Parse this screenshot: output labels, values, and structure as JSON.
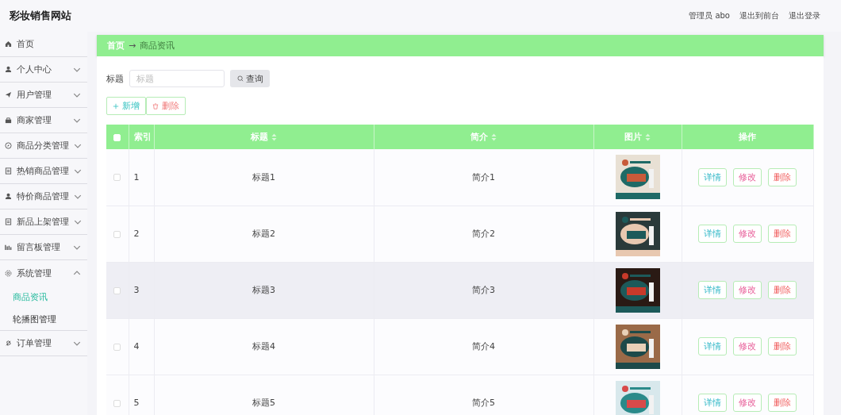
{
  "header": {
    "title": "彩妆销售网站",
    "links": [
      "管理员 abo",
      "退出到前台",
      "退出登录"
    ]
  },
  "sidebar": {
    "items": [
      {
        "label": "首页",
        "kind": "home",
        "expandable": false
      },
      {
        "label": "个人中心",
        "kind": "user",
        "expandable": true,
        "expanded": false
      },
      {
        "label": "用户管理",
        "kind": "send",
        "expandable": true,
        "expanded": false
      },
      {
        "label": "商家管理",
        "kind": "shop",
        "expandable": true,
        "expanded": false
      },
      {
        "label": "商品分类管理",
        "kind": "compass",
        "expandable": true,
        "expanded": false
      },
      {
        "label": "热销商品管理",
        "kind": "doc",
        "expandable": true,
        "expanded": false
      },
      {
        "label": "特价商品管理",
        "kind": "user",
        "expandable": true,
        "expanded": false
      },
      {
        "label": "新品上架管理",
        "kind": "doc",
        "expandable": true,
        "expanded": false
      },
      {
        "label": "留言板管理",
        "kind": "chart",
        "expandable": true,
        "expanded": false
      },
      {
        "label": "系统管理",
        "kind": "gear",
        "expandable": true,
        "expanded": true,
        "children": [
          {
            "label": "商品资讯",
            "selected": true
          },
          {
            "label": "轮播图管理",
            "selected": false
          }
        ]
      },
      {
        "label": "订单管理",
        "kind": "bell",
        "expandable": true,
        "expanded": false
      }
    ]
  },
  "breadcrumb": {
    "home": "首页",
    "arrow": "→",
    "current": "商品资讯"
  },
  "search": {
    "label": "标题",
    "placeholder": "标题",
    "button": "查询"
  },
  "actions": {
    "add": "新增",
    "delete": "删除"
  },
  "table": {
    "columns": [
      {
        "label": "索引",
        "sortable": false
      },
      {
        "label": "标题",
        "sortable": true
      },
      {
        "label": "简介",
        "sortable": true
      },
      {
        "label": "图片",
        "sortable": true
      },
      {
        "label": "操作",
        "sortable": false
      }
    ],
    "header_checked": false,
    "rows": [
      {
        "index": "1",
        "title": "标题1",
        "intro": "简介1",
        "checked": false,
        "highlighted": false,
        "buttons": [
          "详情",
          "修改",
          "删除"
        ]
      },
      {
        "index": "2",
        "title": "标题2",
        "intro": "简介2",
        "checked": false,
        "highlighted": false,
        "buttons": [
          "详情",
          "修改",
          "删除"
        ]
      },
      {
        "index": "3",
        "title": "标题3",
        "intro": "简介3",
        "checked": false,
        "highlighted": true,
        "buttons": [
          "详情",
          "修改",
          "删除"
        ]
      },
      {
        "index": "4",
        "title": "标题4",
        "intro": "简介4",
        "checked": false,
        "highlighted": false,
        "buttons": [
          "详情",
          "修改",
          "删除"
        ]
      },
      {
        "index": "5",
        "title": "标题5",
        "intro": "简介5",
        "checked": false,
        "highlighted": false,
        "buttons": [
          "详情",
          "修改",
          "删除"
        ]
      }
    ]
  }
}
